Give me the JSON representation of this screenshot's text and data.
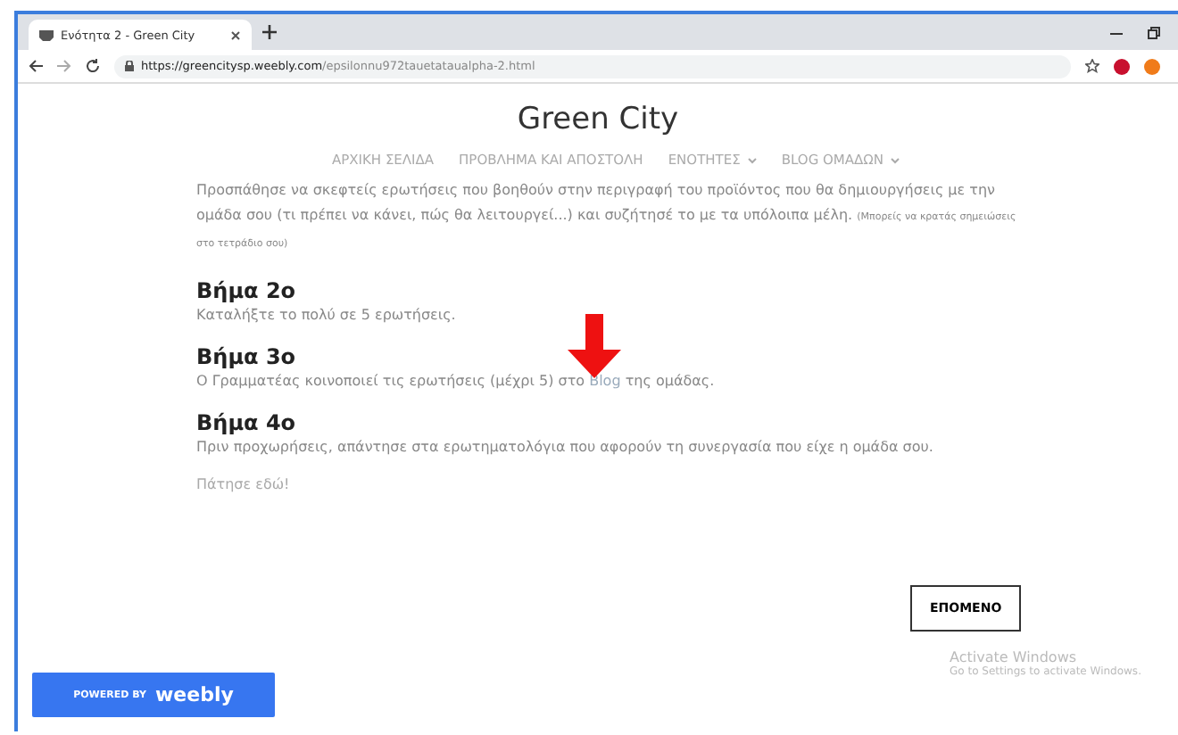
{
  "browser": {
    "tab_title": "Ενότητα 2 - Green City",
    "url_host": "https://greencitysp.weebly.com",
    "url_path": "/epsilonnu972tauetataualpha-2.html"
  },
  "site": {
    "title": "Green City",
    "nav": [
      {
        "label": "ΑΡΧΙΚΗ ΣΕΛΙΔΑ",
        "has_dropdown": false
      },
      {
        "label": "ΠΡΟΒΛΗΜΑ ΚΑΙ ΑΠΟΣΤΟΛΗ",
        "has_dropdown": false
      },
      {
        "label": "ΕΝΟΤΗΤΕΣ",
        "has_dropdown": true
      },
      {
        "label": "BLOG ΟΜΑΔΩΝ",
        "has_dropdown": true
      }
    ]
  },
  "intro": {
    "text": "Προσπάθησε να σκεφτείς ερωτήσεις που βοηθούν στην περιγραφή του προϊόντος που θα δημιουργήσεις με την ομάδα σου (τι πρέπει να κάνει, πώς θα λειτουργεί...) και συζήτησέ το με τα υπόλοιπα μέλη.",
    "note": "(Μπορείς να κρατάς σημειώσεις στο τετράδιο σου)"
  },
  "steps": [
    {
      "heading": "Βήμα 2ο",
      "text": "Καταλήξτε το πολύ σε 5 ερωτήσεις."
    },
    {
      "heading": "Βήμα 3ο",
      "text": "Ο Γραμματέας κοινοποιεί τις ερωτήσεις (μέχρι 5) στο",
      "link": "Blog",
      "text_after": "της ομάδας."
    },
    {
      "heading": "Βήμα 4ο",
      "text": "Πριν προχωρήσεις, απάντησε στα ερωτηματολόγια που αφορούν τη συνεργασία που είχε η ομάδα σου."
    }
  ],
  "press_link": "Πάτησε εδώ!",
  "next_button": "ΕΠΟΜΕΝΟ",
  "badge": {
    "prefix": "POWERED BY",
    "brand": "weebly"
  },
  "activation": {
    "title": "Activate Windows",
    "subtitle": "Go to Settings to activate Windows."
  }
}
